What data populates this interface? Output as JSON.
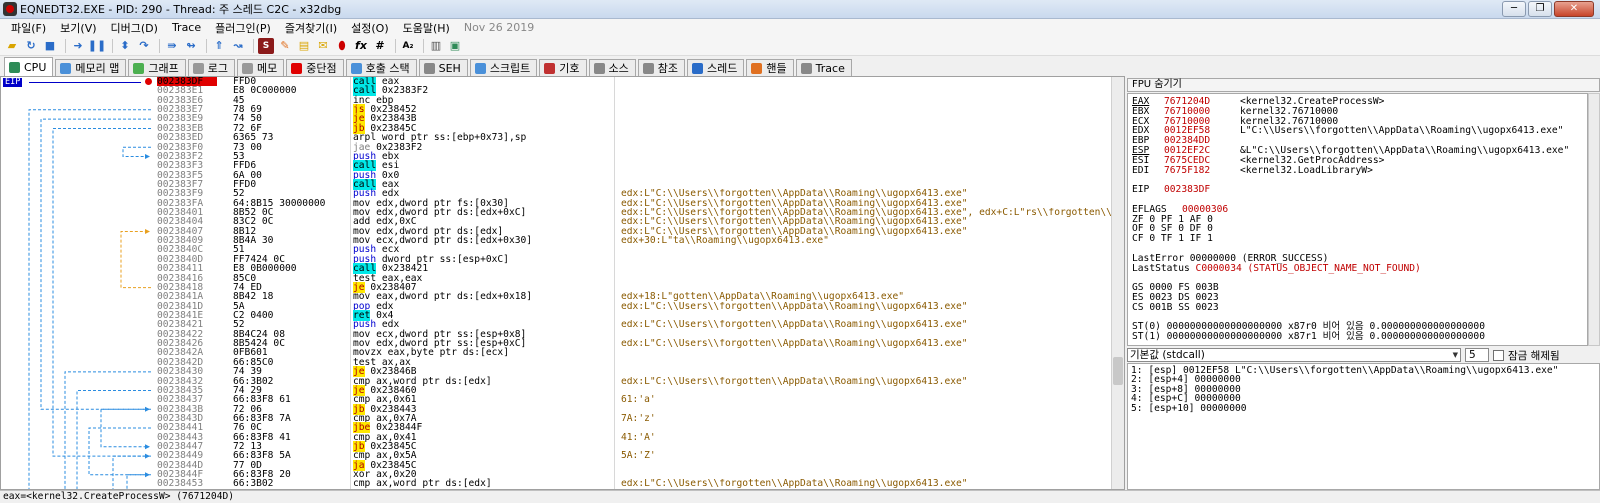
{
  "window": {
    "title": "EQNEDT32.EXE - PID: 290 - Thread: 주 스레드 C2C - x32dbg",
    "minimize": "─",
    "maximize": "❐",
    "close": "✕"
  },
  "menu": {
    "items": [
      "파일(F)",
      "보기(V)",
      "디버그(D)",
      "Trace",
      "플러그인(P)",
      "즐겨찾기(I)",
      "설정(O)",
      "도움말(H)"
    ],
    "date": "Nov 26 2019"
  },
  "toolbar": {
    "icons": [
      "open-icon",
      "restart-icon",
      "stop-icon",
      "run-icon",
      "pause-icon",
      "step-into-icon",
      "step-over-icon",
      "trace-into-icon",
      "trace-over-icon",
      "execute-till-return-icon",
      "run-to-user-code-icon",
      "scylla-icon",
      "patch-icon",
      "comment-icon",
      "label-icon",
      "bookmark-icon",
      "function-icon",
      "hash-icon",
      "string-icon",
      "module-icon",
      "thread-icon"
    ]
  },
  "tabs": [
    {
      "label": "CPU",
      "icon": "cpu-icon",
      "color": "#2e8b57",
      "active": true
    },
    {
      "label": "메모리 맵",
      "icon": "memory-map-icon",
      "color": "#4a90d9",
      "active": false
    },
    {
      "label": "그래프",
      "icon": "graph-icon",
      "color": "#4caf50",
      "active": false
    },
    {
      "label": "로그",
      "icon": "log-icon",
      "color": "#999999",
      "active": false
    },
    {
      "label": "메모",
      "icon": "notes-icon",
      "color": "#999999",
      "active": false
    },
    {
      "label": "중단점",
      "icon": "breakpoint-icon",
      "color": "#e00000",
      "active": false
    },
    {
      "label": "호출 스택",
      "icon": "callstack-icon",
      "color": "#4a90d9",
      "active": false
    },
    {
      "label": "SEH",
      "icon": "seh-icon",
      "color": "#888888",
      "active": false
    },
    {
      "label": "스크립트",
      "icon": "script-icon",
      "color": "#4a90d9",
      "active": false
    },
    {
      "label": "기호",
      "icon": "symbols-icon",
      "color": "#c03030",
      "active": false
    },
    {
      "label": "소스",
      "icon": "source-icon",
      "color": "#888888",
      "active": false
    },
    {
      "label": "참조",
      "icon": "references-icon",
      "color": "#888888",
      "active": false
    },
    {
      "label": "스레드",
      "icon": "threads-icon",
      "color": "#2a6cc8",
      "active": false
    },
    {
      "label": "핸들",
      "icon": "handles-icon",
      "color": "#e07020",
      "active": false
    },
    {
      "label": "Trace",
      "icon": "trace-icon",
      "color": "#888888",
      "active": false
    }
  ],
  "eip_label": "EIP",
  "disasm": [
    {
      "addr": "002383DF",
      "bytes": "FFD0",
      "mn": "call",
      "op": "eax",
      "cmt": "",
      "cls": "call",
      "current": true
    },
    {
      "addr": "002383E1",
      "bytes": "E8 0C000000",
      "mn": "call",
      "op": "0x2383F2",
      "cmt": "",
      "cls": "call"
    },
    {
      "addr": "002383E6",
      "bytes": "45",
      "mn": "inc",
      "op": "ebp",
      "cmt": "",
      "cls": ""
    },
    {
      "addr": "002383E7",
      "bytes": "78 69",
      "mn": "js",
      "op": "0x238452",
      "cmt": "",
      "cls": "jcc",
      "jump": "v"
    },
    {
      "addr": "002383E9",
      "bytes": "74 50",
      "mn": "je",
      "op": "0x23843B",
      "cmt": "",
      "cls": "jcc",
      "jump": "v"
    },
    {
      "addr": "002383EB",
      "bytes": "72 6F",
      "mn": "jb",
      "op": "0x23845C",
      "cmt": "",
      "cls": "jcc",
      "jump": "v"
    },
    {
      "addr": "002383ED",
      "bytes": "6365 73",
      "mn": "arpl",
      "op": "word ptr ss:[ebp+0x73],sp",
      "cmt": "",
      "cls": ""
    },
    {
      "addr": "002383F0",
      "bytes": "73 00",
      "mn": "jae",
      "op": "0x2383F2",
      "cmt": "",
      "cls": "jae",
      "jump": "v"
    },
    {
      "addr": "002383F2",
      "bytes": "53",
      "mn": "push",
      "op": "ebx",
      "cmt": "",
      "cls": "push",
      "jump": ">"
    },
    {
      "addr": "002383F3",
      "bytes": "FFD6",
      "mn": "call",
      "op": "esi",
      "cmt": "",
      "cls": "call"
    },
    {
      "addr": "002383F5",
      "bytes": "6A 00",
      "mn": "push",
      "op": "0x0",
      "cmt": "",
      "cls": "push"
    },
    {
      "addr": "002383F7",
      "bytes": "FFD0",
      "mn": "call",
      "op": "eax",
      "cmt": "",
      "cls": "call"
    },
    {
      "addr": "002383F9",
      "bytes": "52",
      "mn": "push",
      "op": "edx",
      "cmt": "edx:L\"C:\\\\Users\\\\forgotten\\\\AppData\\\\Roaming\\\\ugopx6413.exe\"",
      "cls": "push"
    },
    {
      "addr": "002383FA",
      "bytes": "64:8B15 30000000",
      "mn": "mov",
      "op": "edx,dword ptr fs:[0x30]",
      "cmt": "edx:L\"C:\\\\Users\\\\forgotten\\\\AppData\\\\Roaming\\\\ugopx6413.exe\"",
      "cls": ""
    },
    {
      "addr": "00238401",
      "bytes": "8B52 0C",
      "mn": "mov",
      "op": "edx,dword ptr ds:[edx+0xC]",
      "cmt": "edx:L\"C:\\\\Users\\\\forgotten\\\\AppData\\\\Roaming\\\\ugopx6413.exe\", edx+C:L\"rs\\\\forgotten\\\\A",
      "cls": ""
    },
    {
      "addr": "00238404",
      "bytes": "83C2 0C",
      "mn": "add",
      "op": "edx,0xC",
      "cmt": "edx:L\"C:\\\\Users\\\\forgotten\\\\AppData\\\\Roaming\\\\ugopx6413.exe\"",
      "cls": ""
    },
    {
      "addr": "00238407",
      "bytes": "8B12",
      "mn": "mov",
      "op": "edx,dword ptr ds:[edx]",
      "cmt": "edx:L\"C:\\\\Users\\\\forgotten\\\\AppData\\\\Roaming\\\\ugopx6413.exe\"",
      "cls": "",
      "jump": ">"
    },
    {
      "addr": "00238409",
      "bytes": "8B4A 30",
      "mn": "mov",
      "op": "ecx,dword ptr ds:[edx+0x30]",
      "cmt": "edx+30:L\"ta\\\\Roaming\\\\ugopx6413.exe\"",
      "cls": ""
    },
    {
      "addr": "0023840C",
      "bytes": "51",
      "mn": "push",
      "op": "ecx",
      "cmt": "",
      "cls": "push"
    },
    {
      "addr": "0023840D",
      "bytes": "FF7424 0C",
      "mn": "push",
      "op": "dword ptr ss:[esp+0xC]",
      "cmt": "",
      "cls": "push"
    },
    {
      "addr": "00238411",
      "bytes": "E8 0B000000",
      "mn": "call",
      "op": "0x238421",
      "cmt": "",
      "cls": "call"
    },
    {
      "addr": "00238416",
      "bytes": "85C0",
      "mn": "test",
      "op": "eax,eax",
      "cmt": "",
      "cls": ""
    },
    {
      "addr": "00238418",
      "bytes": "74 ED",
      "mn": "je",
      "op": "0x238407",
      "cmt": "",
      "cls": "jcc",
      "jump": "^"
    },
    {
      "addr": "0023841A",
      "bytes": "8B42 18",
      "mn": "mov",
      "op": "eax,dword ptr ds:[edx+0x18]",
      "cmt": "edx+18:L\"gotten\\\\AppData\\\\Roaming\\\\ugopx6413.exe\"",
      "cls": ""
    },
    {
      "addr": "0023841D",
      "bytes": "5A",
      "mn": "pop",
      "op": "edx",
      "cmt": "edx:L\"C:\\\\Users\\\\forgotten\\\\AppData\\\\Roaming\\\\ugopx6413.exe\"",
      "cls": "push"
    },
    {
      "addr": "0023841E",
      "bytes": "C2 0400",
      "mn": "ret",
      "op": "0x4",
      "cmt": "",
      "cls": "ret"
    },
    {
      "addr": "00238421",
      "bytes": "52",
      "mn": "push",
      "op": "edx",
      "cmt": "edx:L\"C:\\\\Users\\\\forgotten\\\\AppData\\\\Roaming\\\\ugopx6413.exe\"",
      "cls": "push",
      "jump": ">"
    },
    {
      "addr": "00238422",
      "bytes": "8B4C24 08",
      "mn": "mov",
      "op": "ecx,dword ptr ss:[esp+0x8]",
      "cmt": "",
      "cls": ""
    },
    {
      "addr": "00238426",
      "bytes": "8B5424 0C",
      "mn": "mov",
      "op": "edx,dword ptr ss:[esp+0xC]",
      "cmt": "edx:L\"C:\\\\Users\\\\forgotten\\\\AppData\\\\Roaming\\\\ugopx6413.exe\"",
      "cls": ""
    },
    {
      "addr": "0023842A",
      "bytes": "0FB601",
      "mn": "movzx",
      "op": "eax,byte ptr ds:[ecx]",
      "cmt": "",
      "cls": ""
    },
    {
      "addr": "0023842D",
      "bytes": "66:85C0",
      "mn": "test",
      "op": "ax,ax",
      "cmt": "",
      "cls": ""
    },
    {
      "addr": "00238430",
      "bytes": "74 39",
      "mn": "je",
      "op": "0x23846B",
      "cmt": "",
      "cls": "jcc",
      "jump": "v"
    },
    {
      "addr": "00238432",
      "bytes": "66:3B02",
      "mn": "cmp",
      "op": "ax,word ptr ds:[edx]",
      "cmt": "edx:L\"C:\\\\Users\\\\forgotten\\\\AppData\\\\Roaming\\\\ugopx6413.exe\"",
      "cls": ""
    },
    {
      "addr": "00238435",
      "bytes": "74 29",
      "mn": "je",
      "op": "0x238460",
      "cmt": "",
      "cls": "jcc",
      "jump": "v"
    },
    {
      "addr": "00238437",
      "bytes": "66:83F8 61",
      "mn": "cmp",
      "op": "ax,0x61",
      "cmt": "61:'a'",
      "cls": ""
    },
    {
      "addr": "0023843B",
      "bytes": "72 06",
      "mn": "jb",
      "op": "0x238443",
      "cmt": "",
      "cls": "jcc",
      "jump": "v"
    },
    {
      "addr": "0023843D",
      "bytes": "66:83F8 7A",
      "mn": "cmp",
      "op": "ax,0x7A",
      "cmt": "7A:'z'",
      "cls": ""
    },
    {
      "addr": "00238441",
      "bytes": "76 0C",
      "mn": "jbe",
      "op": "0x23844F",
      "cmt": "",
      "cls": "jcc",
      "jump": "v"
    },
    {
      "addr": "00238443",
      "bytes": "66:83F8 41",
      "mn": "cmp",
      "op": "ax,0x41",
      "cmt": "41:'A'",
      "cls": "",
      "jump": ">"
    },
    {
      "addr": "00238447",
      "bytes": "72 13",
      "mn": "jb",
      "op": "0x23845C",
      "cmt": "",
      "cls": "jcc",
      "jump": "v"
    },
    {
      "addr": "00238449",
      "bytes": "66:83F8 5A",
      "mn": "cmp",
      "op": "ax,0x5A",
      "cmt": "5A:'Z'",
      "cls": ""
    },
    {
      "addr": "0023844D",
      "bytes": "77 0D",
      "mn": "ja",
      "op": "0x23845C",
      "cmt": "",
      "cls": "jcc",
      "jump": "v"
    },
    {
      "addr": "0023844F",
      "bytes": "66:83F8 20",
      "mn": "xor",
      "op": "ax,0x20",
      "cmt": "",
      "cls": "",
      "jump": ">"
    },
    {
      "addr": "00238453",
      "bytes": "66:3B02",
      "mn": "cmp",
      "op": "ax,word ptr ds:[edx]",
      "cmt": "edx:L\"C:\\\\Users\\\\forgotten\\\\AppData\\\\Roaming\\\\ugopx6413.exe\"",
      "cls": ""
    }
  ],
  "fpu_header": "FPU 숨기기",
  "registers": [
    {
      "name": "EAX",
      "val": "7671204D",
      "cmt": "<kernel32.CreateProcessW>",
      "ul": true
    },
    {
      "name": "EBX",
      "val": "76710000",
      "cmt": "kernel32.76710000"
    },
    {
      "name": "ECX",
      "val": "76710000",
      "cmt": "kernel32.76710000"
    },
    {
      "name": "EDX",
      "val": "0012EF58",
      "cmt": "L\"C:\\\\Users\\\\forgotten\\\\AppData\\\\Roaming\\\\ugopx6413.exe\""
    },
    {
      "name": "EBP",
      "val": "002384DD",
      "cmt": ""
    },
    {
      "name": "ESP",
      "val": "0012EF2C",
      "cmt": "&L\"C:\\\\Users\\\\forgotten\\\\AppData\\\\Roaming\\\\ugopx6413.exe\"",
      "ul": true
    },
    {
      "name": "ESI",
      "val": "7675CEDC",
      "cmt": "<kernel32.GetProcAddress>"
    },
    {
      "name": "EDI",
      "val": "7675F182",
      "cmt": "<kernel32.LoadLibraryW>"
    },
    {
      "name": "",
      "val": "",
      "cmt": ""
    },
    {
      "name": "EIP",
      "val": "002383DF",
      "cmt": ""
    },
    {
      "name": "",
      "val": "",
      "cmt": ""
    },
    {
      "name": "EFLAGS",
      "val": "00000306",
      "cmt": "",
      "wide": true
    }
  ],
  "flags": [
    "ZF 0  PF 1  AF 0",
    "OF 0  SF 0  DF 0",
    "CF 0  TF 1  IF 1"
  ],
  "last_error": {
    "label": "LastError",
    "val": "00000000 (ERROR_SUCCESS)"
  },
  "last_status": {
    "label": "LastStatus",
    "val": "C0000034 (STATUS_OBJECT_NAME_NOT_FOUND)"
  },
  "segments": [
    "GS 0000  FS 003B",
    "ES 0023  DS 0023",
    "CS 001B  SS 0023"
  ],
  "fpu_rows": [
    "ST(0) 00000000000000000000 x87r0 비어 있음 0.000000000000000000",
    "ST(1) 00000000000000000000 x87r1 비어 있음 0.000000000000000000"
  ],
  "stack_controls": {
    "callconv": "기본값 (stdcall)",
    "argcount": "5",
    "unlock_label": "잠금 해제됨"
  },
  "stack_args": [
    "1: [esp] 0012EF58 L\"C:\\\\Users\\\\forgotten\\\\AppData\\\\Roaming\\\\ugopx6413.exe\"",
    "2: [esp+4] 00000000",
    "3: [esp+8] 00000000",
    "4: [esp+C] 00000000",
    "5: [esp+10] 00000000"
  ],
  "status": "eax=<kernel32.CreateProcessW> (7671204D)",
  "colors": {
    "current_addr_bg": "#e00000",
    "call_bg": "#00e8e8",
    "jcc_bg": "#ffe800",
    "register_changed": "#c00000",
    "jump_line": "#2a8ce0",
    "jump_line_orange": "#e8a020"
  }
}
